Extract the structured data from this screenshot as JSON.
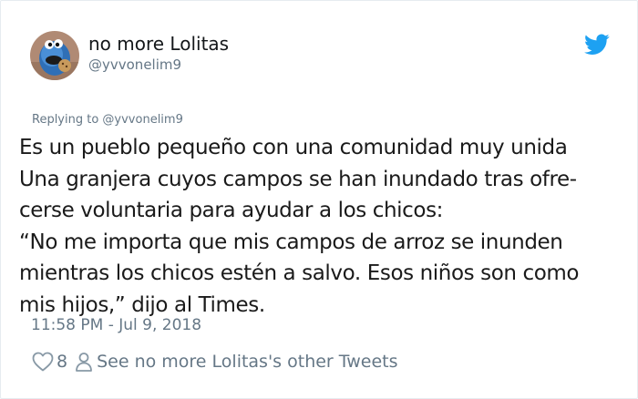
{
  "user": {
    "display_name": "no more Lolitas",
    "handle": "@yvvonelim9",
    "avatar_icon": "cookie-monster-avatar"
  },
  "reply_context": "Replying to @yvvonelim9",
  "tweet": {
    "lines": [
      "Es un pueblo pequeño con una comunidad muy unida",
      "Una granjera cuyos campos se han inundado tras ofre-",
      "cerse voluntaria para ayudar a los chicos:",
      "“No me importa que mis campos de arroz se inunden",
      "mientras los chicos estén a salvo. Esos niños son como",
      "mis hijos,” dijo al Times."
    ],
    "timestamp": "11:58 PM - Jul 9, 2018"
  },
  "actions": {
    "like_count": "8",
    "profile_link": "See no more Lolitas's other Tweets"
  },
  "colors": {
    "twitter_blue": "#1da1f2",
    "secondary_text": "#657786",
    "primary_text": "#14171a"
  }
}
